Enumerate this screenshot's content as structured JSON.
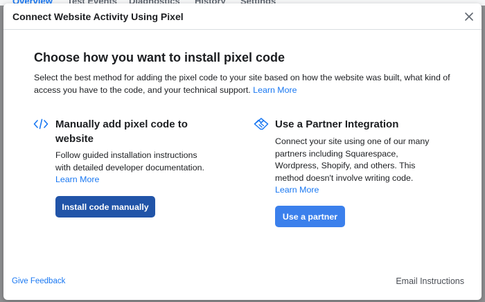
{
  "background_tabs": [
    "Overview",
    "Test Events",
    "Diagnostics",
    "History",
    "Settings"
  ],
  "modal": {
    "title": "Connect Website Activity Using Pixel"
  },
  "content": {
    "title": "Choose how you want to install pixel code",
    "description": "Select the best method for adding the pixel code to your site based on how the website was built, what kind of access you have to the code, and your technical support.",
    "learn_more": "Learn More"
  },
  "options": [
    {
      "icon": "code-icon",
      "title": "Manually add pixel code to website",
      "description": "Follow guided installation instructions with detailed developer documentation.",
      "learn_more": "Learn More",
      "button": "Install code manually"
    },
    {
      "icon": "handshake-icon",
      "title": "Use a Partner Integration",
      "description": "Connect your site using one of our many partners including Squarespace, Wordpress, Shopify, and others. This method doesn't involve writing code.",
      "learn_more": "Learn More",
      "button": "Use a partner"
    }
  ],
  "footer": {
    "feedback": "Give Feedback",
    "email": "Email Instructions"
  },
  "colors": {
    "link": "#1877f2",
    "primary_dark": "#2154a8",
    "primary_light": "#3b80ec"
  }
}
